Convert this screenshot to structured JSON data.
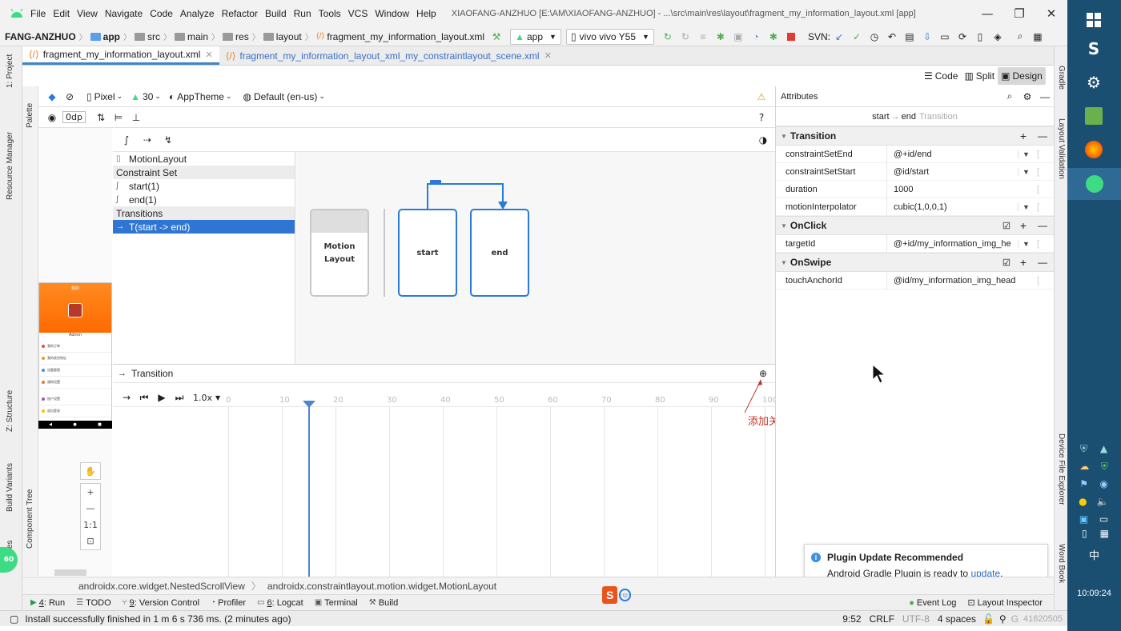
{
  "menu": [
    "File",
    "Edit",
    "View",
    "Navigate",
    "Code",
    "Analyze",
    "Refactor",
    "Build",
    "Run",
    "Tools",
    "VCS",
    "Window",
    "Help"
  ],
  "window_title": "XIAOFANG-ANZHUO [E:\\AM\\XIAOFANG-ANZHUO] - ...\\src\\main\\res\\layout\\fragment_my_information_layout.xml [app]",
  "nav": {
    "crumbs": [
      "FANG-ANZHUO",
      "app",
      "src",
      "main",
      "res",
      "layout",
      "fragment_my_information_layout.xml"
    ],
    "run_config": "app",
    "device": "vivo vivo Y55",
    "svn": "SVN:"
  },
  "tabs": [
    {
      "label": "fragment_my_information_layout.xml"
    },
    {
      "label": "fragment_my_information_layout_xml_my_constraintlayout_scene.xml"
    }
  ],
  "left_strip": {
    "project": "1: Project",
    "resource": "Resource Manager",
    "structure": "Z: Structure",
    "variants": "Build Variants",
    "favorites": "orites"
  },
  "right_strip": {
    "gradle": "Gradle",
    "layout_validation": "Layout Validation",
    "device_explorer": "Device File Explorer",
    "word_book": "Word Book"
  },
  "palette": {
    "palette": "Palette",
    "component_tree": "Component Tree"
  },
  "view_modes": {
    "code": "Code",
    "split": "Split",
    "design": "Design"
  },
  "design_toolbar": {
    "device": "Pixel",
    "api": "30",
    "theme": "AppTheme",
    "locale": "Default (en-us)",
    "margin": "0dp"
  },
  "motion": {
    "items": [
      {
        "label": "MotionLayout",
        "kind": "item"
      },
      {
        "label": "Constraint Set",
        "kind": "hdr"
      },
      {
        "label": "start(1)",
        "kind": "item"
      },
      {
        "label": "end(1)",
        "kind": "item"
      },
      {
        "label": "Transitions",
        "kind": "hdr"
      },
      {
        "label": "T(start -> end)",
        "kind": "sel"
      }
    ],
    "graph": {
      "motion_box": "Motion Layout",
      "start": "start",
      "end": "end"
    }
  },
  "preview": {
    "title": "我的",
    "user": "Admin",
    "rows": [
      "我的订单",
      "我的收货地址",
      "设备管理",
      "通知设置",
      "账户设置",
      "退出登录"
    ]
  },
  "timeline": {
    "title": "Transition",
    "speed": "1.0x",
    "ticks": [
      "0",
      "10",
      "20",
      "30",
      "40",
      "50",
      "60",
      "70",
      "80",
      "90",
      "100"
    ],
    "annotation": "添加关键帧",
    "cursor": 0
  },
  "zoom": {
    "ratio": "1:1"
  },
  "attributes": {
    "title": "Attributes",
    "breadcrumb_from": "start",
    "breadcrumb_to": "end",
    "breadcrumb_type": "Transition",
    "sections": [
      {
        "name": "Transition",
        "rows": [
          {
            "n": "constraintSetEnd",
            "v": "@+id/end",
            "dd": true
          },
          {
            "n": "constraintSetStart",
            "v": "@id/start",
            "dd": true
          },
          {
            "n": "duration",
            "v": "1000",
            "dd": false
          },
          {
            "n": "motionInterpolator",
            "v": "cubic(1,0,0,1)",
            "dd": true
          }
        ]
      },
      {
        "name": "OnClick",
        "rows": [
          {
            "n": "targetId",
            "v": "@+id/my_information_img_he",
            "dd": true
          }
        ]
      },
      {
        "name": "OnSwipe",
        "rows": [
          {
            "n": "touchAnchorId",
            "v": "@id/my_information_img_head",
            "dd": false
          }
        ]
      }
    ]
  },
  "notification": {
    "title": "Plugin Update Recommended",
    "body": "Android Gradle Plugin is ready to ",
    "link": "update",
    "end": "."
  },
  "breadcrumbs": {
    "a": "androidx.core.widget.NestedScrollView",
    "b": "androidx.constraintlayout.motion.widget.MotionLayout"
  },
  "toolwindows": [
    {
      "n": "4",
      "label": ": Run"
    },
    {
      "n": "",
      "label": "TODO"
    },
    {
      "n": "9",
      "label": ": Version Control"
    },
    {
      "n": "",
      "label": "Profiler"
    },
    {
      "n": "6",
      "label": ": Logcat"
    },
    {
      "n": "",
      "label": "Terminal"
    },
    {
      "n": "",
      "label": "Build"
    }
  ],
  "toolwindows_right": {
    "event": "Event Log",
    "inspector": "Layout Inspector"
  },
  "status": {
    "message": "Install successfully finished in 1 m 6 s 736 ms. (2 minutes ago)",
    "pos": "9:52",
    "le": "CRLF",
    "enc": "UTF-8",
    "indent": "4 spaces",
    "watermark": "41620505"
  },
  "clock": "10:09:24",
  "ime": "中",
  "badge": "60",
  "colors": {
    "accent": "#2a7bd8",
    "selection": "#2f76d2",
    "taskbar": "#1b4f72",
    "annotation": "#c0392b"
  }
}
